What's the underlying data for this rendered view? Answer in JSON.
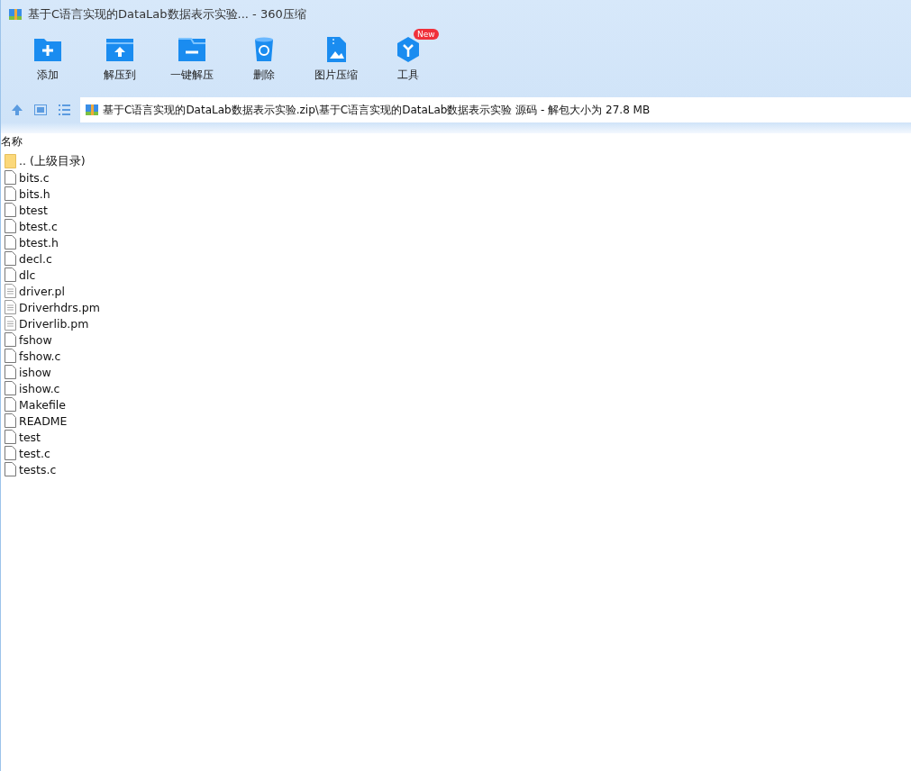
{
  "window": {
    "title": "基于C语言实现的DataLab数据表示实验... - 360压缩"
  },
  "toolbar": [
    {
      "label": "添加",
      "kind": "add"
    },
    {
      "label": "解压到",
      "kind": "extract"
    },
    {
      "label": "一键解压",
      "kind": "quick"
    },
    {
      "label": "删除",
      "kind": "delete"
    },
    {
      "label": "图片压缩",
      "kind": "image"
    },
    {
      "label": "工具",
      "kind": "tools",
      "badge": "New"
    }
  ],
  "address": {
    "path": "基于C语言实现的DataLab数据表示实验.zip\\基于C语言实现的DataLab数据表示实验 源码 - 解包大小为 27.8 MB"
  },
  "table": {
    "columns": [
      "名称"
    ],
    "rows": [
      {
        "name": ".. (上级目录)",
        "kind": "folder"
      },
      {
        "name": "bits.c",
        "kind": "file"
      },
      {
        "name": "bits.h",
        "kind": "file"
      },
      {
        "name": "btest",
        "kind": "file"
      },
      {
        "name": "btest.c",
        "kind": "file"
      },
      {
        "name": "btest.h",
        "kind": "file"
      },
      {
        "name": "decl.c",
        "kind": "file"
      },
      {
        "name": "dlc",
        "kind": "file"
      },
      {
        "name": "driver.pl",
        "kind": "text"
      },
      {
        "name": "Driverhdrs.pm",
        "kind": "text"
      },
      {
        "name": "Driverlib.pm",
        "kind": "text"
      },
      {
        "name": "fshow",
        "kind": "file"
      },
      {
        "name": "fshow.c",
        "kind": "file"
      },
      {
        "name": "ishow",
        "kind": "file"
      },
      {
        "name": "ishow.c",
        "kind": "file"
      },
      {
        "name": "Makefile",
        "kind": "file"
      },
      {
        "name": "README",
        "kind": "file"
      },
      {
        "name": "test",
        "kind": "file"
      },
      {
        "name": "test.c",
        "kind": "file"
      },
      {
        "name": "tests.c",
        "kind": "file"
      }
    ]
  }
}
